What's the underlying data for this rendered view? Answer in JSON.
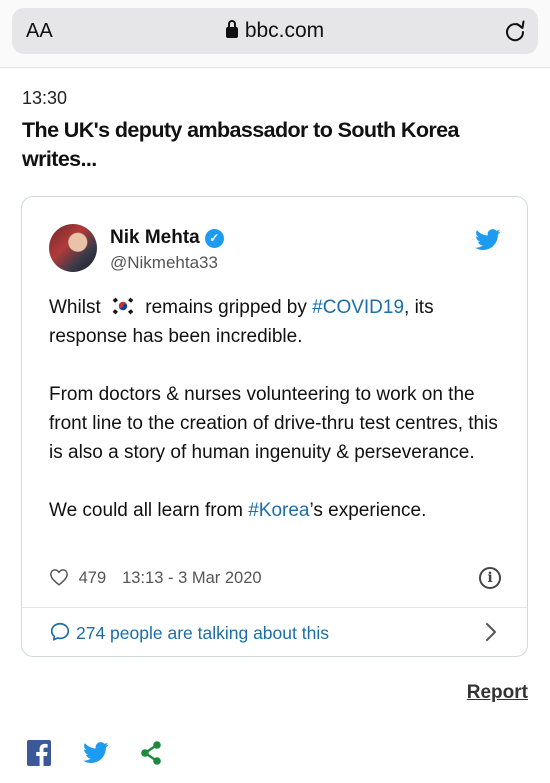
{
  "browser": {
    "text_size_label": "AA",
    "domain": "bbc.com"
  },
  "article": {
    "time": "13:30",
    "headline": "The UK's deputy ambassador to South Korea writes..."
  },
  "tweet": {
    "author_name": "Nik Mehta",
    "author_handle": "@Nikmehta33",
    "para1_before": "Whilst ",
    "para1_middle": " remains gripped by ",
    "para1_hashtag": "#COVID19",
    "para1_after": ", its response has been incredible.",
    "para2": "From doctors & nurses volunteering to work on the front line to the creation of drive-thru test centres, this is also a story of human ingenuity & perseverance.",
    "para3_before": "We could all learn from ",
    "para3_hashtag": "#Korea",
    "para3_after": "’s experience.",
    "likes": "479",
    "timestamp": "13:13 - 3 Mar 2020",
    "talking_label": "274 people are talking about this"
  },
  "footer": {
    "report_label": "Report"
  },
  "colors": {
    "link_blue": "#1b6ea8",
    "twitter_blue": "#1d9bf0",
    "facebook_blue": "#3b5998",
    "share_green": "#1d8a3c"
  }
}
